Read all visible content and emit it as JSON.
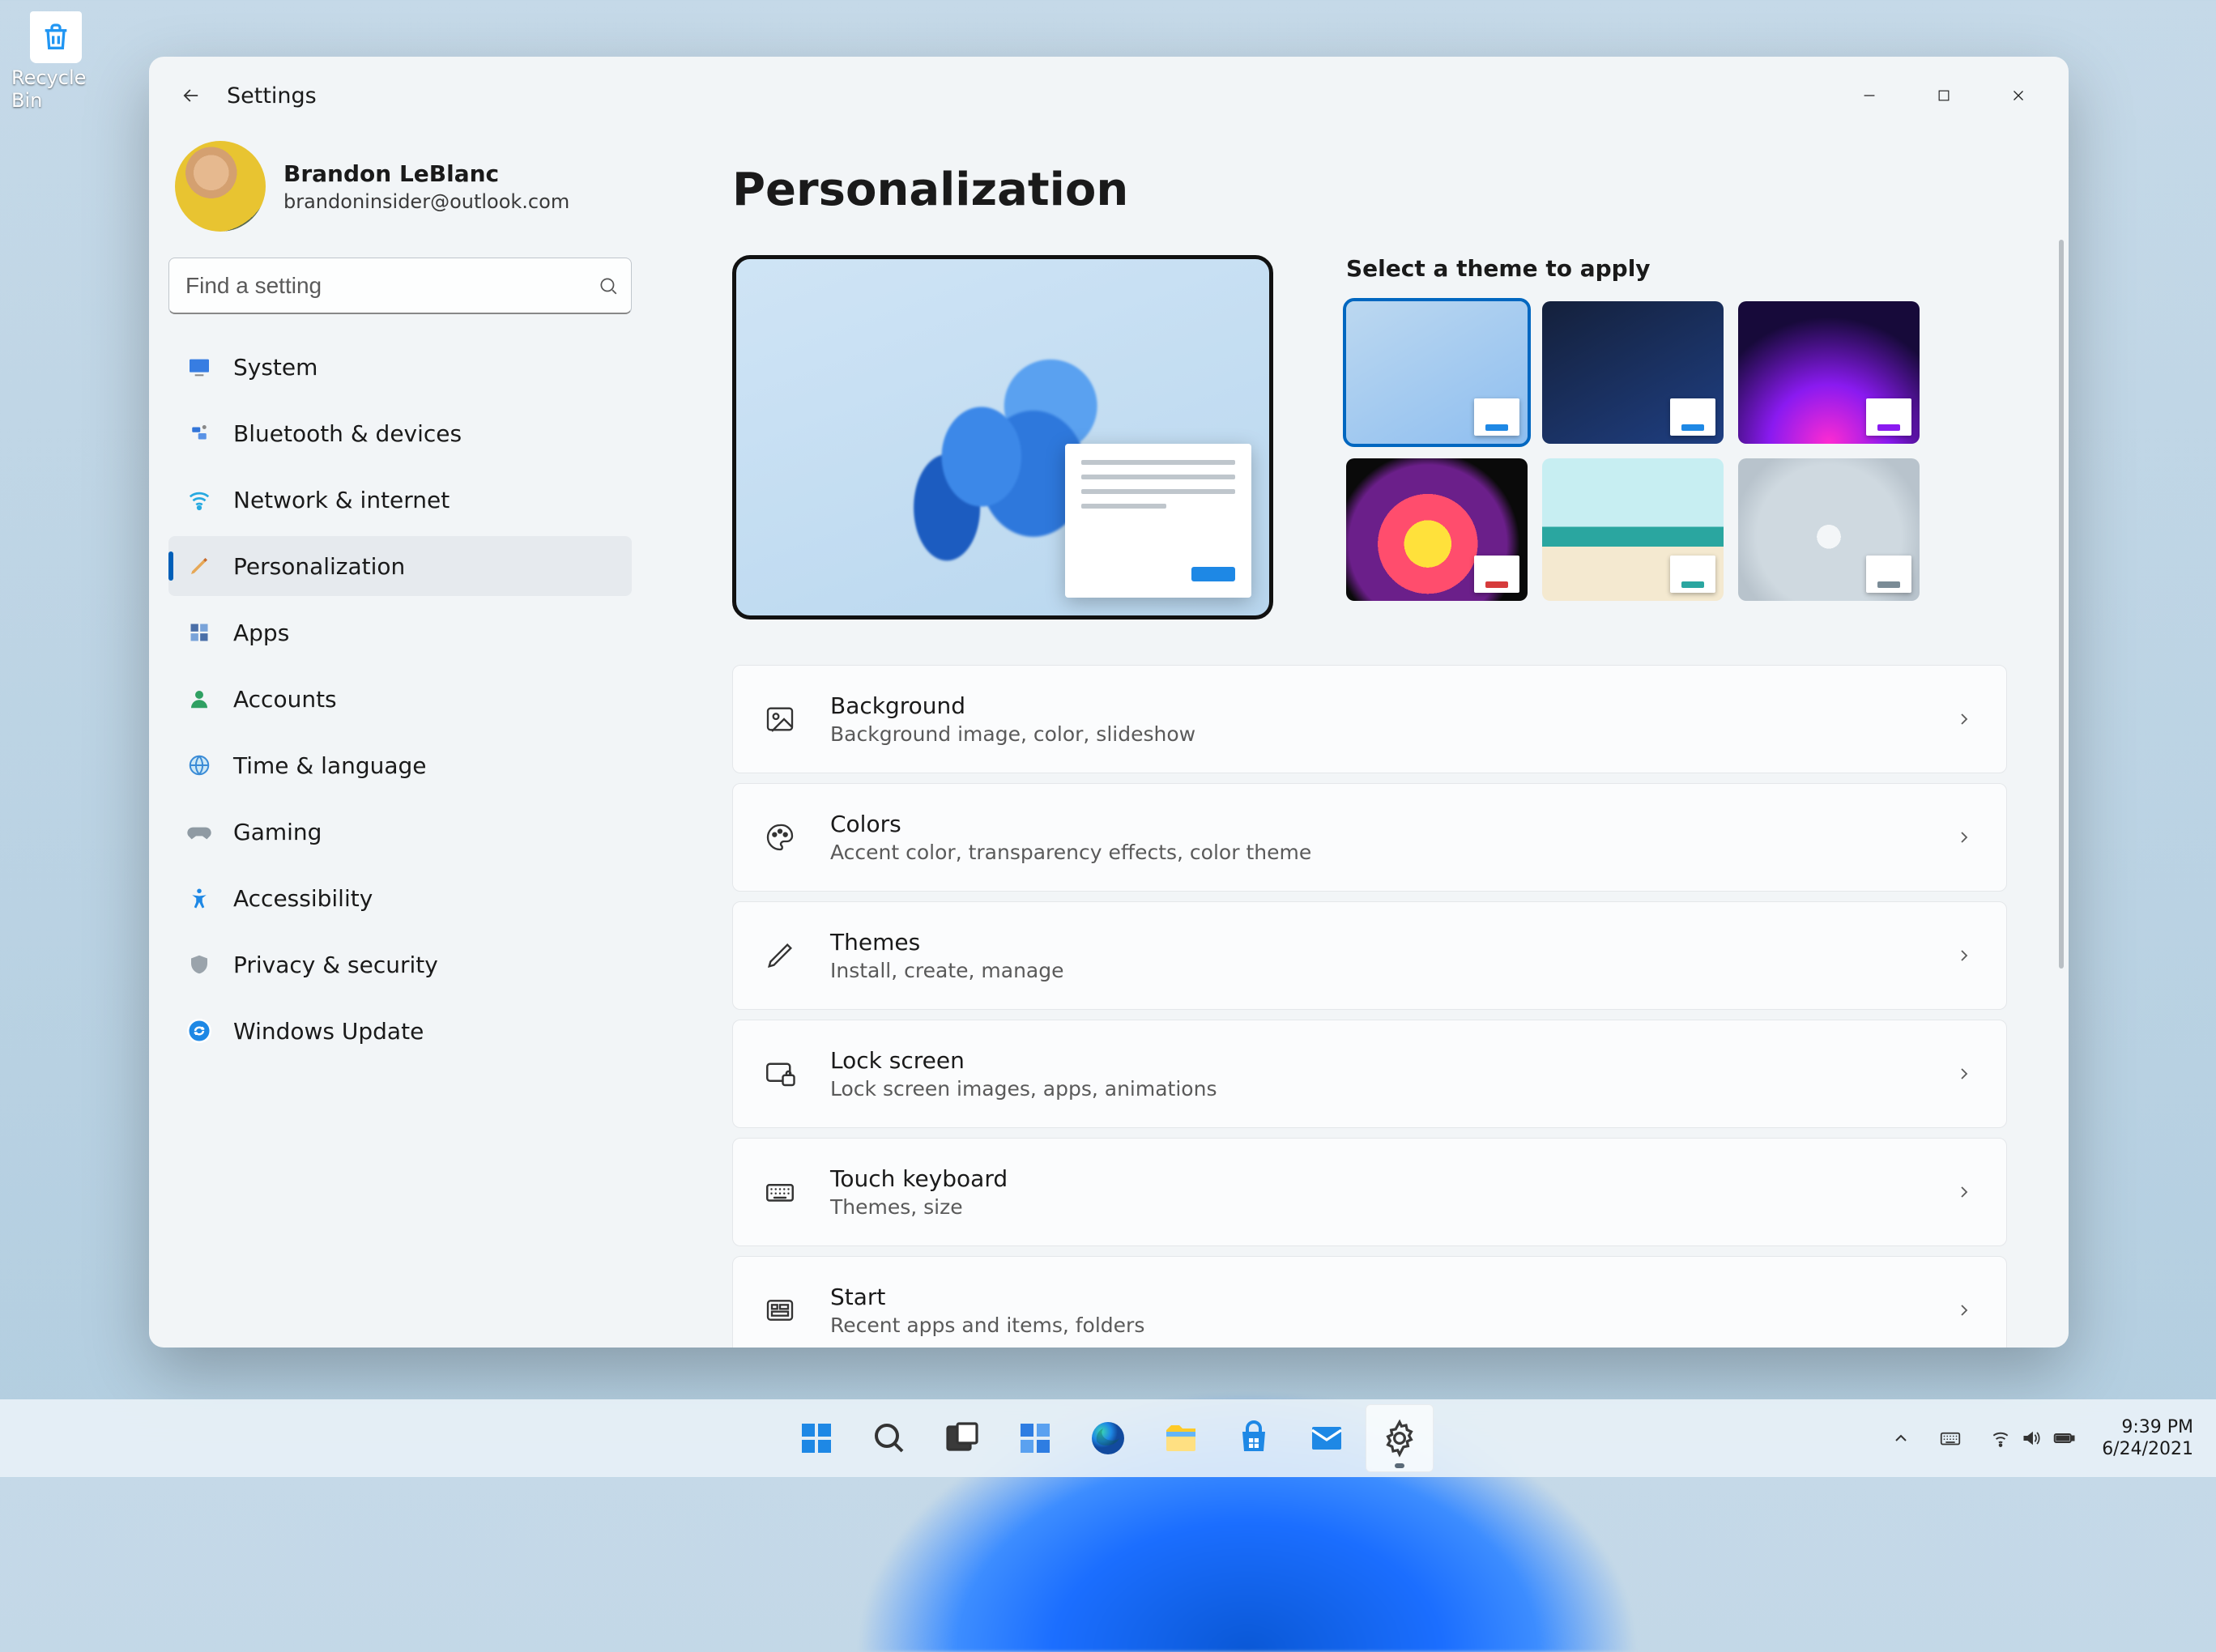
{
  "desktop": {
    "recycle_bin_label": "Recycle Bin"
  },
  "window": {
    "app_title": "Settings"
  },
  "profile": {
    "name": "Brandon LeBlanc",
    "email": "brandoninsider@outlook.com"
  },
  "search": {
    "placeholder": "Find a setting"
  },
  "sidebar": {
    "items": [
      {
        "label": "System"
      },
      {
        "label": "Bluetooth & devices"
      },
      {
        "label": "Network & internet"
      },
      {
        "label": "Personalization"
      },
      {
        "label": "Apps"
      },
      {
        "label": "Accounts"
      },
      {
        "label": "Time & language"
      },
      {
        "label": "Gaming"
      },
      {
        "label": "Accessibility"
      },
      {
        "label": "Privacy & security"
      },
      {
        "label": "Windows Update"
      }
    ]
  },
  "main": {
    "title": "Personalization",
    "select_theme_label": "Select a theme to apply",
    "themes": [
      {
        "bg": "linear-gradient(150deg,#bcd8f0,#8ebef0)",
        "accent": "#1e88e5",
        "selected": true
      },
      {
        "bg": "linear-gradient(150deg,#14203b,#1f3f82)",
        "accent": "#1e88e5",
        "selected": false
      },
      {
        "bg": "radial-gradient(circle at 50% 100%, #ff2bd1 0%, #8a1af0 35%, #170a3a 75%)",
        "accent": "#8a1af0",
        "selected": false
      },
      {
        "bg": "radial-gradient(circle at 45% 60%, #ffe13b 0 18%, #ff4d6d 18% 38%, #6b1f8a 38% 60%, #0a0a0a 70%)",
        "accent": "#d63b3b",
        "selected": false
      },
      {
        "bg": "linear-gradient(180deg,#c7eef2 0 48%, #2aa6a0 48% 62%, #f4e9d0 62%)",
        "accent": "#2aa6a0",
        "selected": false
      },
      {
        "bg": "radial-gradient(circle at 50% 55%, #f3f6f8 0 10%, #cfd9e0 10% 60%, #b8c3cc 80%)",
        "accent": "#7a8b96",
        "selected": false
      }
    ],
    "cards": [
      {
        "title": "Background",
        "subtitle": "Background image, color, slideshow",
        "icon": "image-icon"
      },
      {
        "title": "Colors",
        "subtitle": "Accent color, transparency effects, color theme",
        "icon": "palette-icon"
      },
      {
        "title": "Themes",
        "subtitle": "Install, create, manage",
        "icon": "pen-icon"
      },
      {
        "title": "Lock screen",
        "subtitle": "Lock screen images, apps, animations",
        "icon": "lock-screen-icon"
      },
      {
        "title": "Touch keyboard",
        "subtitle": "Themes, size",
        "icon": "keyboard-icon"
      },
      {
        "title": "Start",
        "subtitle": "Recent apps and items, folders",
        "icon": "start-layout-icon"
      }
    ]
  },
  "taskbar": {
    "time": "9:39 PM",
    "date": "6/24/2021"
  }
}
